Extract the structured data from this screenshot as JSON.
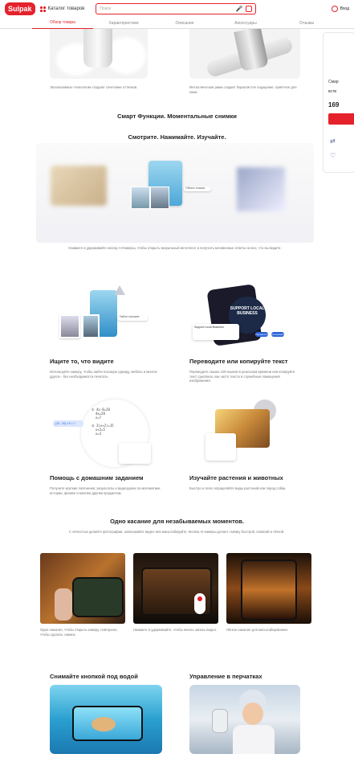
{
  "header": {
    "logo": "Sulpak",
    "catalog_label": "Каталог товаров",
    "search_placeholder": "Поиск",
    "account_label": "Вход"
  },
  "tabs": [
    {
      "label": "Обзор товара",
      "active": true
    },
    {
      "label": "Характеристики",
      "active": false
    },
    {
      "label": "Описание",
      "active": false
    },
    {
      "label": "Аксессуары",
      "active": false
    },
    {
      "label": "Отзывы",
      "active": false
    }
  ],
  "side_panel": {
    "text1": "Смар",
    "text2": "вств",
    "price": "169"
  },
  "top_captions": {
    "left": "Эксклюзивные технологии создают сочетание оттенков.",
    "right": "Металлическая рама создаёт бархатистое ощущение, приятное для кожи."
  },
  "smart": {
    "title": "Смарт Функции. Моментальные снимки",
    "subtitle": "Смотрите. Нажимайте. Изучайте.",
    "chip": "Объект поиска",
    "caption": "Нажмите и удерживайте кнопку AI-Камеры, чтобы открыть визуальный интеллект и получить мгновенные ответы на все, что вы видите."
  },
  "features": [
    {
      "title": "Ищите то, что видите",
      "desc": "Используйте камеру, чтобы найти похожую одежду, мебель и многое другое - без необходимости печатать."
    },
    {
      "title": "Переводите или копируйте текст",
      "desc": "Переводите свыше 100 языков в реальном времени или копируйте текст рукописи, как часто текста в служебные помещения изображения."
    },
    {
      "title": "Помощь с домашним заданием",
      "desc": "Получите краткие пояснения, результаты и видеоуроки по математике, истории, физике и многим другим предметам."
    },
    {
      "title": "Изучайте растения и животных",
      "desc": "Быстро и легко определяйте виды растений или пород собак."
    }
  ],
  "search_chip": "Найти похожее",
  "translate": {
    "sign": "SUPPORT LOCAL BUSINESS",
    "card_title": "Support Local Business",
    "btn1": "Перевести",
    "btn2": "Копировать"
  },
  "math_chip": "(10 - 20) x 5 = ?",
  "one_touch": {
    "title": "Одно касание для незабываемых моментов.",
    "subtitle": "С лёгкостью делайте фотографии, записывайте видео или масштабируйте. Кнопка AI-камеры делает съёмку быстрой, плавной и лёгкой.",
    "captions": [
      "Одно нажатие, чтобы открыть камеру, повторное, чтобы сделать снимок.",
      "Нажмите и удерживайте, чтобы начать запись видео.",
      "Лёгкое нажатие для масштабирования."
    ]
  },
  "bottom": {
    "left_title": "Снимайте кнопкой под водой",
    "right_title": "Управление в перчатках"
  },
  "colors": {
    "brand": "#e5222c",
    "accent_blue": "#2a63d8"
  }
}
